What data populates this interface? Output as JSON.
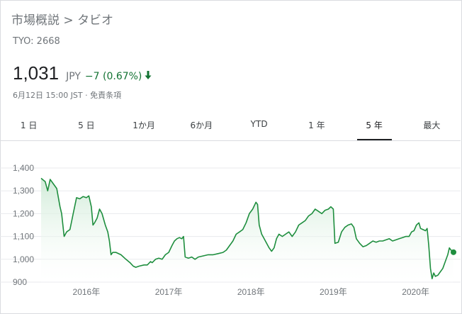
{
  "breadcrumb": {
    "root": "市場概説",
    "separator": ">",
    "company": "タビオ"
  },
  "ticker": "TYO: 2668",
  "quote": {
    "price": "1,031",
    "currency": "JPY",
    "change": "−7 (0.67%)",
    "direction_icon": "arrow-down-icon",
    "timestamp": "6月12日 15:00 JST · 免責条項"
  },
  "tabs": [
    {
      "label": "1 日",
      "active": false
    },
    {
      "label": "5 日",
      "active": false
    },
    {
      "label": "1か月",
      "active": false
    },
    {
      "label": "6か月",
      "active": false
    },
    {
      "label": "YTD",
      "active": false
    },
    {
      "label": "1 年",
      "active": false
    },
    {
      "label": "5 年",
      "active": true
    },
    {
      "label": "最大",
      "active": false
    }
  ],
  "colors": {
    "line": "#1e8e3e",
    "fill_top": "#ceead6",
    "gridline": "#e8eaed",
    "text_muted": "#70757a",
    "down": "#137333"
  },
  "chart_data": {
    "type": "area",
    "title": "",
    "xlabel": "",
    "ylabel": "",
    "ylim": [
      900,
      1400
    ],
    "y_ticks": [
      "1,400",
      "1,300",
      "1,200",
      "1,100",
      "1,000",
      "900"
    ],
    "y_tick_values": [
      1400,
      1300,
      1200,
      1100,
      1000,
      900
    ],
    "x_ticks": [
      {
        "label": "2016年",
        "value": 2016.0
      },
      {
        "label": "2017年",
        "value": 2017.0
      },
      {
        "label": "2018年",
        "value": 2018.0
      },
      {
        "label": "2019年",
        "value": 2019.0
      },
      {
        "label": "2020年",
        "value": 2020.0
      }
    ],
    "xlim": [
      2015.45,
      2020.46
    ],
    "grid": true,
    "series": [
      {
        "points": [
          [
            2015.45,
            1355
          ],
          [
            2015.5,
            1340
          ],
          [
            2015.53,
            1300
          ],
          [
            2015.56,
            1350
          ],
          [
            2015.6,
            1330
          ],
          [
            2015.64,
            1310
          ],
          [
            2015.68,
            1230
          ],
          [
            2015.7,
            1200
          ],
          [
            2015.73,
            1100
          ],
          [
            2015.76,
            1120
          ],
          [
            2015.8,
            1130
          ],
          [
            2015.84,
            1200
          ],
          [
            2015.88,
            1270
          ],
          [
            2015.92,
            1265
          ],
          [
            2015.96,
            1275
          ],
          [
            2016.0,
            1270
          ],
          [
            2016.03,
            1278
          ],
          [
            2016.06,
            1230
          ],
          [
            2016.08,
            1150
          ],
          [
            2016.1,
            1160
          ],
          [
            2016.13,
            1180
          ],
          [
            2016.16,
            1220
          ],
          [
            2016.19,
            1200
          ],
          [
            2016.23,
            1150
          ],
          [
            2016.26,
            1120
          ],
          [
            2016.28,
            1080
          ],
          [
            2016.3,
            1020
          ],
          [
            2016.32,
            1030
          ],
          [
            2016.36,
            1030
          ],
          [
            2016.42,
            1020
          ],
          [
            2016.48,
            1000
          ],
          [
            2016.53,
            985
          ],
          [
            2016.57,
            970
          ],
          [
            2016.6,
            965
          ],
          [
            2016.64,
            970
          ],
          [
            2016.7,
            975
          ],
          [
            2016.74,
            975
          ],
          [
            2016.78,
            990
          ],
          [
            2016.8,
            985
          ],
          [
            2016.84,
            1000
          ],
          [
            2016.88,
            1005
          ],
          [
            2016.92,
            1000
          ],
          [
            2016.96,
            1020
          ],
          [
            2017.0,
            1030
          ],
          [
            2017.04,
            1060
          ],
          [
            2017.07,
            1080
          ],
          [
            2017.1,
            1090
          ],
          [
            2017.13,
            1095
          ],
          [
            2017.16,
            1090
          ],
          [
            2017.18,
            1100
          ],
          [
            2017.2,
            1010
          ],
          [
            2017.24,
            1005
          ],
          [
            2017.28,
            1010
          ],
          [
            2017.32,
            1000
          ],
          [
            2017.36,
            1010
          ],
          [
            2017.42,
            1015
          ],
          [
            2017.48,
            1020
          ],
          [
            2017.54,
            1020
          ],
          [
            2017.6,
            1025
          ],
          [
            2017.66,
            1030
          ],
          [
            2017.7,
            1040
          ],
          [
            2017.74,
            1060
          ],
          [
            2017.78,
            1080
          ],
          [
            2017.82,
            1110
          ],
          [
            2017.86,
            1120
          ],
          [
            2017.9,
            1130
          ],
          [
            2017.94,
            1160
          ],
          [
            2017.98,
            1200
          ],
          [
            2018.02,
            1220
          ],
          [
            2018.06,
            1250
          ],
          [
            2018.08,
            1240
          ],
          [
            2018.1,
            1150
          ],
          [
            2018.13,
            1110
          ],
          [
            2018.16,
            1090
          ],
          [
            2018.19,
            1070
          ],
          [
            2018.22,
            1050
          ],
          [
            2018.25,
            1035
          ],
          [
            2018.28,
            1050
          ],
          [
            2018.31,
            1090
          ],
          [
            2018.34,
            1110
          ],
          [
            2018.38,
            1100
          ],
          [
            2018.42,
            1110
          ],
          [
            2018.46,
            1120
          ],
          [
            2018.5,
            1100
          ],
          [
            2018.54,
            1120
          ],
          [
            2018.58,
            1150
          ],
          [
            2018.62,
            1160
          ],
          [
            2018.66,
            1170
          ],
          [
            2018.7,
            1190
          ],
          [
            2018.74,
            1200
          ],
          [
            2018.78,
            1220
          ],
          [
            2018.82,
            1210
          ],
          [
            2018.86,
            1200
          ],
          [
            2018.9,
            1215
          ],
          [
            2018.94,
            1220
          ],
          [
            2018.97,
            1230
          ],
          [
            2019.0,
            1220
          ],
          [
            2019.02,
            1070
          ],
          [
            2019.06,
            1075
          ],
          [
            2019.1,
            1120
          ],
          [
            2019.14,
            1140
          ],
          [
            2019.18,
            1150
          ],
          [
            2019.22,
            1155
          ],
          [
            2019.25,
            1140
          ],
          [
            2019.28,
            1090
          ],
          [
            2019.32,
            1070
          ],
          [
            2019.36,
            1055
          ],
          [
            2019.4,
            1060
          ],
          [
            2019.44,
            1070
          ],
          [
            2019.48,
            1080
          ],
          [
            2019.52,
            1075
          ],
          [
            2019.56,
            1080
          ],
          [
            2019.6,
            1080
          ],
          [
            2019.64,
            1085
          ],
          [
            2019.68,
            1090
          ],
          [
            2019.72,
            1080
          ],
          [
            2019.76,
            1085
          ],
          [
            2019.8,
            1090
          ],
          [
            2019.84,
            1095
          ],
          [
            2019.88,
            1100
          ],
          [
            2019.92,
            1100
          ],
          [
            2019.95,
            1120
          ],
          [
            2019.98,
            1125
          ],
          [
            2020.01,
            1150
          ],
          [
            2020.04,
            1160
          ],
          [
            2020.06,
            1135
          ],
          [
            2020.09,
            1130
          ],
          [
            2020.12,
            1125
          ],
          [
            2020.14,
            1135
          ],
          [
            2020.16,
            1060
          ],
          [
            2020.18,
            960
          ],
          [
            2020.2,
            915
          ],
          [
            2020.22,
            940
          ],
          [
            2020.24,
            925
          ],
          [
            2020.27,
            930
          ],
          [
            2020.3,
            945
          ],
          [
            2020.33,
            960
          ],
          [
            2020.36,
            990
          ],
          [
            2020.39,
            1020
          ],
          [
            2020.41,
            1050
          ],
          [
            2020.43,
            1040
          ],
          [
            2020.46,
            1031
          ]
        ]
      }
    ],
    "last_point_marker": true
  }
}
